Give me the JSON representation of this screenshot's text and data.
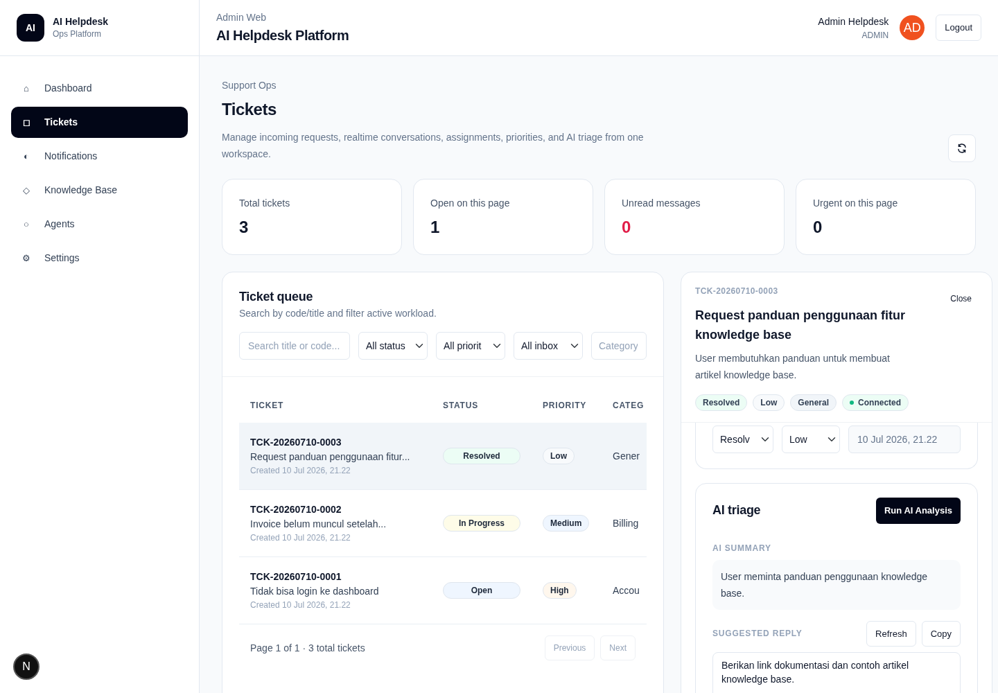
{
  "brand": {
    "logo": "AI",
    "name": "AI Helpdesk",
    "subtitle": "Ops Platform"
  },
  "nav": [
    {
      "icon": "⌂",
      "label": "Dashboard",
      "selected": false
    },
    {
      "icon": "◻",
      "label": "Tickets",
      "selected": true
    },
    {
      "icon": "◐",
      "label": "Notifications",
      "selected": false
    },
    {
      "icon": "◇",
      "label": "Knowledge Base",
      "selected": false
    },
    {
      "icon": "○",
      "label": "Agents",
      "selected": false
    },
    {
      "icon": "⚙",
      "label": "Settings",
      "selected": false
    }
  ],
  "dev_badge": "N",
  "header": {
    "eyebrow": "Admin Web",
    "title": "AI Helpdesk Platform",
    "user": {
      "name": "Admin Helpdesk",
      "role": "ADMIN",
      "initials": "AD"
    },
    "logout": "Logout"
  },
  "page": {
    "eyebrow": "Support Ops",
    "title": "Tickets",
    "description": "Manage incoming requests, realtime conversations, assignments, priorities, and AI triage from one workspace."
  },
  "stats": [
    {
      "label": "Total tickets",
      "value": "3",
      "color": "#0f172a"
    },
    {
      "label": "Open on this page",
      "value": "1",
      "color": "#0f172a"
    },
    {
      "label": "Unread messages",
      "value": "0",
      "color": "#e11d48"
    },
    {
      "label": "Urgent on this page",
      "value": "0",
      "color": "#0f172a"
    }
  ],
  "queue": {
    "title": "Ticket queue",
    "subtitle": "Search by code/title and filter active workload.",
    "search": {
      "placeholder": "Search title or code..."
    },
    "filters": [
      {
        "kind": "select",
        "value": "All status"
      },
      {
        "kind": "select",
        "value": "All priorit"
      },
      {
        "kind": "select",
        "value": "All inbox"
      },
      {
        "kind": "input",
        "placeholder": "Category"
      }
    ],
    "columns": [
      "TICKET",
      "STATUS",
      "PRIORITY",
      "CATEG"
    ],
    "rows": [
      {
        "code": "TCK-20260710-0003",
        "title": "Request panduan penggunaan fitur...",
        "created": "Created 10 Jul 2026, 21.22",
        "status": {
          "label": "Resolved",
          "color": "#ecfdf5"
        },
        "priority": {
          "label": "Low",
          "color": "#f8fafc"
        },
        "category": "Gener",
        "selected": true
      },
      {
        "code": "TCK-20260710-0002",
        "title": "Invoice belum muncul setelah...",
        "created": "Created 10 Jul 2026, 21.22",
        "status": {
          "label": "In Progress",
          "color": "#fefce8"
        },
        "priority": {
          "label": "Medium",
          "color": "#eff6ff"
        },
        "category": "Billing",
        "selected": false
      },
      {
        "code": "TCK-20260710-0001",
        "title": "Tidak bisa login ke dashboard",
        "created": "Created 10 Jul 2026, 21.22",
        "status": {
          "label": "Open",
          "color": "#eff6ff"
        },
        "priority": {
          "label": "High",
          "color": "#fff7ed"
        },
        "category": "Accou",
        "selected": false
      }
    ],
    "footer": "Page 1 of 1 · 3 total tickets",
    "pager": [
      {
        "label": "Previous",
        "disabled": true
      },
      {
        "label": "Next",
        "disabled": true
      }
    ]
  },
  "detail": {
    "code": "TCK-20260710-0003",
    "close": "Close",
    "title": "Request panduan penggunaan fitur knowledge base",
    "description": "User membutuhkan panduan untuk membuat artikel knowledge base.",
    "tags": [
      {
        "label": "Resolved",
        "color": "#ecfdf5",
        "dot": false
      },
      {
        "label": "Low",
        "color": "#f8fafc",
        "dot": false
      },
      {
        "label": "General",
        "color": "#f1f5f9",
        "dot": false
      },
      {
        "label": "Connected",
        "color": "#ecfdf5",
        "dot": true
      }
    ],
    "controls": [
      {
        "kind": "select",
        "value": "Resolv"
      },
      {
        "kind": "select",
        "value": "Low"
      },
      {
        "kind": "readonly",
        "value": "10 Jul 2026, 21.22"
      }
    ],
    "triage": {
      "title": "AI triage",
      "run": "Run AI Analysis",
      "summary_label": "AI SUMMARY",
      "summary": "User meminta panduan penggunaan knowledge base.",
      "reply_label": "SUGGESTED REPLY",
      "reply_buttons": [
        "Refresh",
        "Copy"
      ],
      "reply": "Berikan link dokumentasi dan contoh artikel knowledge base."
    }
  }
}
